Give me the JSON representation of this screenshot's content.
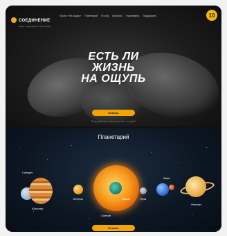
{
  "hero": {
    "logo_text": "СОЕДИНЕНИЕ",
    "logo_sub": "фонд поддержки слепоглухих",
    "nav": [
      "Проект «На ощупь»",
      "Планетарий",
      "Кто мы",
      "Контакты",
      "Участвовать",
      "Поддержать"
    ],
    "anniversary_badge": "10",
    "title_lines": [
      "ЕСТЬ ЛИ",
      "ЖИЗНЬ",
      "НА ОЩУПЬ"
    ],
    "cta_label": "Помочь",
    "hint": "Подержите слепоглухих людей"
  },
  "planetarium": {
    "title": "Планетарий",
    "labels": [
      "Сатурн",
      "Юпитер",
      "Венера",
      "Солнце",
      "Земля",
      "Луна",
      "Марс",
      "Нептун"
    ],
    "cta_label": "Помочь"
  },
  "colors": {
    "accent": "#f5a300",
    "background": "#111111"
  }
}
